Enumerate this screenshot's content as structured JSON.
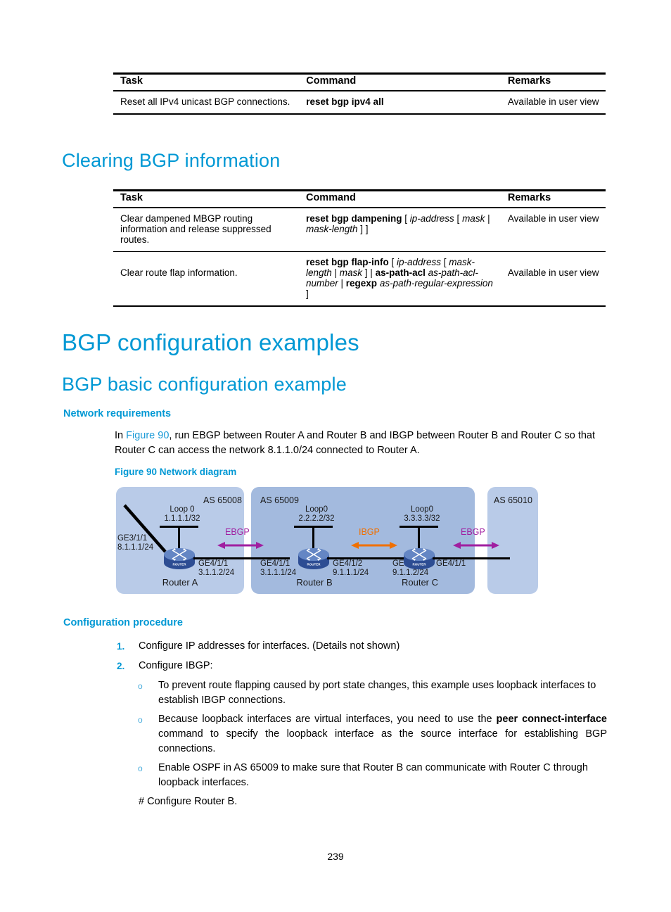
{
  "tables": [
    {
      "name": "reset-bgp-table",
      "headers": [
        "Task",
        "Command",
        "Remarks"
      ],
      "rows": [
        {
          "task": "Reset all IPv4 unicast BGP connections.",
          "command_html": "<b>reset bgp ipv4 all</b>",
          "remarks": "Available in user view"
        }
      ]
    },
    {
      "name": "clearing-bgp-table",
      "headers": [
        "Task",
        "Command",
        "Remarks"
      ],
      "rows": [
        {
          "task": "Clear dampened MBGP routing information and release suppressed routes.",
          "command_html": "<b>reset bgp dampening</b> [ <i>ip-address</i> [ <i>mask</i> | <i>mask-length</i> ] ]",
          "remarks": "Available in user view"
        },
        {
          "task": "Clear route flap information.",
          "command_html": "<b>reset bgp flap-info</b> [ <i>ip-address</i> [ <i>mask-length</i> | <i>mask</i> ] | <b>as-path-acl</b> <i>as-path-acl-number</i> | <b>regexp</b> <i>as-path-regular-expression</i> ]",
          "remarks": "Available in user view"
        }
      ]
    }
  ],
  "headings": {
    "clearing_bgp": "Clearing BGP information",
    "bgp_config_examples": "BGP configuration examples",
    "bgp_basic_example": "BGP basic configuration example",
    "network_requirements": "Network requirements",
    "configuration_procedure": "Configuration procedure"
  },
  "body": {
    "requirements_pre": "In ",
    "requirements_link": "Figure 90",
    "requirements_post": ", run EBGP between Router A and Router B and IBGP between Router B and Router C so that Router C can access the network 8.1.1.0/24 connected to Router A.",
    "figure_caption": "Figure 90 Network diagram",
    "steps": [
      {
        "num": "1.",
        "text": "Configure IP addresses for interfaces. (Details not shown)"
      },
      {
        "num": "2.",
        "text": "Configure IBGP:"
      }
    ],
    "bullets": [
      {
        "marker": "o",
        "html": "To prevent route flapping caused by port state changes, this example uses loopback interfaces to establish IBGP connections."
      },
      {
        "marker": "o",
        "html": "Because loopback interfaces are virtual interfaces, you need to use the <b>peer connect-interface</b> command to specify the loopback interface as the source interface for establishing BGP connections."
      },
      {
        "marker": "o",
        "html": "Enable OSPF in AS 65009 to make sure that Router B can communicate with Router C through loopback interfaces."
      }
    ],
    "configure_router_b": "# Configure Router B.",
    "page_number": "239"
  },
  "diagram": {
    "as_boxes": [
      {
        "label": "AS 65008",
        "fill": "#b9cbe8"
      },
      {
        "label": "AS 65009",
        "fill": "#a3bade"
      },
      {
        "label": "AS 65010",
        "fill": "#b9cbe8"
      }
    ],
    "routers": [
      {
        "name": "Router A",
        "badge": "ROUTER",
        "loopback_name": "Loop 0",
        "loopback_addr": "1.1.1.1/32",
        "left_if_name": "GE3/1/1",
        "left_if_addr": "8.1.1.1/24",
        "right_if_name": "GE4/1/1",
        "right_if_addr": "3.1.1.2/24"
      },
      {
        "name": "Router B",
        "badge": "ROUTER",
        "loopback_name": "Loop0",
        "loopback_addr": "2.2.2.2/32",
        "left_if_name": "GE4/1/1",
        "left_if_addr": "3.1.1.1/24",
        "right_if_name": "GE4/1/2",
        "right_if_addr": "9.1.1.1/24"
      },
      {
        "name": "Router C",
        "badge": "ROUTER",
        "loopback_name": "Loop0",
        "loopback_addr": "3.3.3.3/32",
        "left_if_name": "GE4/1/2",
        "left_if_addr": "9.1.1.2/24",
        "right_if_name": "GE4/1/1",
        "right_if_addr": ""
      }
    ],
    "protocol_links": [
      {
        "label": "EBGP",
        "color": "#a01fa0"
      },
      {
        "label": "IBGP",
        "color": "#f07000"
      },
      {
        "label": "EBGP",
        "color": "#a01fa0"
      }
    ],
    "colors": {
      "router_body": "#3a5fa8",
      "router_top": "#5b7fc4",
      "ebgp": "#a01fa0",
      "ibgp": "#f07000",
      "as_light": "#b9cbe8",
      "as_dark": "#a3bade"
    }
  }
}
